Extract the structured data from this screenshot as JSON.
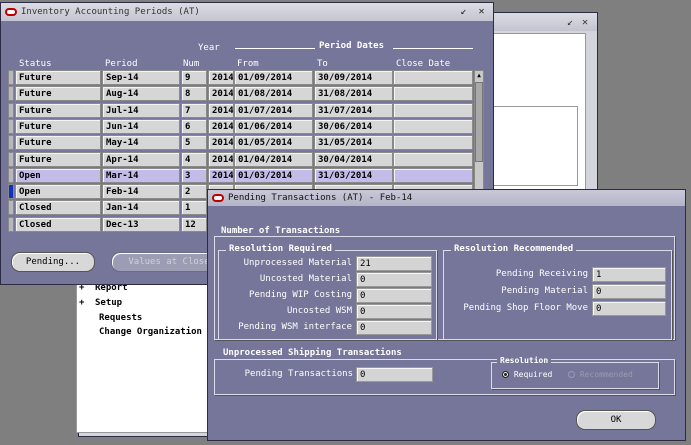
{
  "nav": {
    "items": [
      {
        "expander": "+",
        "label": "Report"
      },
      {
        "expander": "+",
        "label": "Setup"
      },
      {
        "expander": "",
        "label": "Requests"
      },
      {
        "expander": "",
        "label": "Change Organization"
      }
    ]
  },
  "periods_window": {
    "title": "Inventory Accounting Periods (AT)",
    "headers": {
      "status": "Status",
      "period": "Period",
      "year": "Year",
      "num": "Num",
      "period_dates": "Period Dates",
      "from": "From",
      "to": "To",
      "close_date": "Close Date"
    },
    "rows": [
      {
        "status": "Future",
        "period": "Sep-14",
        "num": "9",
        "year": "2014",
        "from": "01/09/2014",
        "to": "30/09/2014",
        "close_date": ""
      },
      {
        "status": "Future",
        "period": "Aug-14",
        "num": "8",
        "year": "2014",
        "from": "01/08/2014",
        "to": "31/08/2014",
        "close_date": ""
      },
      {
        "status": "Future",
        "period": "Jul-14",
        "num": "7",
        "year": "2014",
        "from": "01/07/2014",
        "to": "31/07/2014",
        "close_date": ""
      },
      {
        "status": "Future",
        "period": "Jun-14",
        "num": "6",
        "year": "2014",
        "from": "01/06/2014",
        "to": "30/06/2014",
        "close_date": ""
      },
      {
        "status": "Future",
        "period": "May-14",
        "num": "5",
        "year": "2014",
        "from": "01/05/2014",
        "to": "31/05/2014",
        "close_date": ""
      },
      {
        "status": "Future",
        "period": "Apr-14",
        "num": "4",
        "year": "2014",
        "from": "01/04/2014",
        "to": "30/04/2014",
        "close_date": ""
      },
      {
        "status": "Open",
        "period": "Mar-14",
        "num": "3",
        "year": "2014",
        "from": "01/03/2014",
        "to": "31/03/2014",
        "close_date": ""
      },
      {
        "status": "Open",
        "period": "Feb-14",
        "num": "2",
        "year": "",
        "from": "",
        "to": "",
        "close_date": ""
      },
      {
        "status": "Closed",
        "period": "Jan-14",
        "num": "1",
        "year": "",
        "from": "",
        "to": "",
        "close_date": ""
      },
      {
        "status": "Closed",
        "period": "Dec-13",
        "num": "12",
        "year": "",
        "from": "",
        "to": "",
        "close_date": ""
      }
    ],
    "selected_row": 6,
    "cursor_row": 7,
    "buttons": {
      "pending": "Pending...",
      "values_at_close": "Values at Close"
    }
  },
  "pending_window": {
    "title": "Pending Transactions (AT) - Feb-14",
    "section_title": "Number of Transactions",
    "required": {
      "title": "Resolution Required",
      "fields": [
        {
          "label": "Unprocessed Material",
          "value": "21"
        },
        {
          "label": "Uncosted Material",
          "value": "0"
        },
        {
          "label": "Pending WIP Costing",
          "value": "0"
        },
        {
          "label": "Uncosted WSM",
          "value": "0"
        },
        {
          "label": "Pending WSM interface",
          "value": "0"
        }
      ]
    },
    "recommended": {
      "title": "Resolution Recommended",
      "fields": [
        {
          "label": "Pending Receiving",
          "value": "1"
        },
        {
          "label": "Pending Material",
          "value": "0"
        },
        {
          "label": "Pending Shop Floor Move",
          "value": "0"
        }
      ]
    },
    "shipping": {
      "title": "Unprocessed Shipping Transactions",
      "label": "Pending Transactions",
      "value": "0"
    },
    "resolution": {
      "title": "Resolution",
      "options": [
        {
          "label": "Required",
          "selected": true
        },
        {
          "label": "Recommended",
          "selected": false
        }
      ]
    },
    "ok_label": "OK"
  },
  "colors": {
    "desktop": "#7f7f7f",
    "window": "#76769a",
    "selected_row": "#c4bce8",
    "field": "#d6d6d6"
  }
}
